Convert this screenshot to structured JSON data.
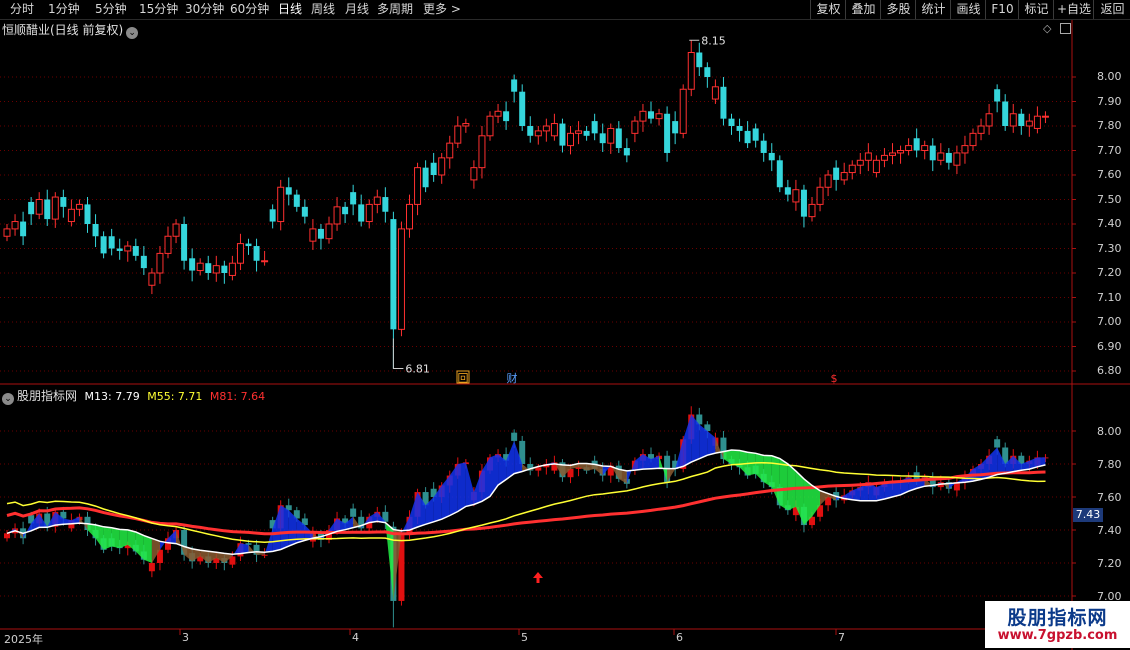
{
  "toolbar": {
    "left": [
      {
        "label": "分时",
        "active": false
      },
      {
        "label": "1分钟",
        "active": false
      },
      {
        "label": "5分钟",
        "active": false
      },
      {
        "label": "15分钟",
        "active": false
      },
      {
        "label": "30分钟",
        "active": false
      },
      {
        "label": "60分钟",
        "active": false
      },
      {
        "label": "日线",
        "active": true
      },
      {
        "label": "周线",
        "active": false
      },
      {
        "label": "月线",
        "active": false
      },
      {
        "label": "多周期",
        "active": false
      },
      {
        "label": "更多 >",
        "active": false
      }
    ],
    "right": [
      "复权",
      "叠加",
      "多股",
      "统计",
      "画线",
      "F10",
      "标记",
      "+自选",
      "返回"
    ]
  },
  "main_panel": {
    "title": "恒顺醋业(日线 前复权)",
    "y_ticks": [
      "8.00",
      "7.90",
      "7.80",
      "7.70",
      "7.60",
      "7.50",
      "7.40",
      "7.30",
      "7.20",
      "7.10",
      "7.00",
      "6.90",
      "6.80"
    ],
    "high_label": "8.15",
    "low_label": "6.81",
    "event_markers": [
      {
        "text": "回",
        "color": "#e8a020"
      },
      {
        "text": "财",
        "color": "#5aa0ff"
      },
      {
        "text": "$",
        "color": "#ff3030"
      }
    ]
  },
  "indicator_panel": {
    "name": "股朋指标网",
    "m13_label": "M13: 7.79",
    "m55_label": "M55: 7.71",
    "m81_label": "M81: 7.64",
    "m13_color": "#ffffff",
    "m55_color": "#ffff33",
    "m81_color": "#ff3030",
    "y_ticks": [
      "8.00",
      "7.80",
      "7.60",
      "7.40",
      "7.20",
      "7.00"
    ],
    "current_price": "7.43"
  },
  "x_axis": [
    "2025年",
    "3",
    "4",
    "5",
    "6",
    "7"
  ],
  "watermark": {
    "title": "股朋指标网",
    "url": "www.7gpzb.com"
  },
  "colors": {
    "up": "#ff3030",
    "down": "#35d6dc",
    "grid": "#6a0000",
    "axis": "#aa1111"
  },
  "chart_data": [
    {
      "type": "candlestick",
      "title": "恒顺醋业(日线 前复权)",
      "ylim": [
        6.78,
        8.22
      ],
      "y_ticks": [
        6.8,
        6.9,
        7.0,
        7.1,
        7.2,
        7.3,
        7.4,
        7.5,
        7.6,
        7.7,
        7.8,
        7.9,
        8.0
      ],
      "x_ticks": [
        "2025年",
        "3",
        "4",
        "5",
        "6",
        "7"
      ],
      "max": 8.15,
      "min": 6.81,
      "close_series": [
        7.38,
        7.41,
        7.35,
        7.44,
        7.5,
        7.42,
        7.51,
        7.47,
        7.46,
        7.48,
        7.4,
        7.35,
        7.28,
        7.3,
        7.29,
        7.31,
        7.27,
        7.22,
        7.2,
        7.28,
        7.35,
        7.4,
        7.25,
        7.21,
        7.24,
        7.2,
        7.23,
        7.2,
        7.24,
        7.32,
        7.31,
        7.25,
        7.25,
        7.41,
        7.55,
        7.52,
        7.47,
        7.43,
        7.38,
        7.34,
        7.4,
        7.47,
        7.44,
        7.48,
        7.41,
        7.48,
        7.51,
        7.45,
        6.97,
        7.38,
        7.48,
        7.63,
        7.55,
        7.6,
        7.67,
        7.73,
        7.8,
        7.81,
        7.63,
        7.76,
        7.84,
        7.86,
        7.82,
        7.94,
        7.8,
        7.76,
        7.78,
        7.8,
        7.81,
        7.72,
        7.77,
        7.78,
        7.76,
        7.77,
        7.73,
        7.79,
        7.71,
        7.68,
        7.82,
        7.86,
        7.83,
        7.85,
        7.69,
        7.77,
        7.95,
        8.1,
        8.04,
        8.0,
        7.96,
        7.83,
        7.8,
        7.78,
        7.73,
        7.74,
        7.69,
        7.66,
        7.55,
        7.52,
        7.54,
        7.43,
        7.48,
        7.55,
        7.6,
        7.58,
        7.61,
        7.64,
        7.66,
        7.69,
        7.66,
        7.68,
        7.69,
        7.7,
        7.72,
        7.7,
        7.72,
        7.66,
        7.69,
        7.65,
        7.69,
        7.72,
        7.77,
        7.8,
        7.85,
        7.9,
        7.8,
        7.85,
        7.8,
        7.82,
        7.84,
        7.84
      ]
    },
    {
      "type": "line",
      "title": "股朋指标网",
      "ylim": [
        6.95,
        8.2
      ],
      "y_ticks": [
        7.0,
        7.2,
        7.4,
        7.6,
        7.8,
        8.0
      ],
      "series": [
        {
          "name": "M13",
          "last": 7.79,
          "color": "#ffffff"
        },
        {
          "name": "M55",
          "last": 7.71,
          "color": "#ffff33"
        },
        {
          "name": "M81",
          "last": 7.64,
          "color": "#ff3030"
        }
      ]
    }
  ]
}
